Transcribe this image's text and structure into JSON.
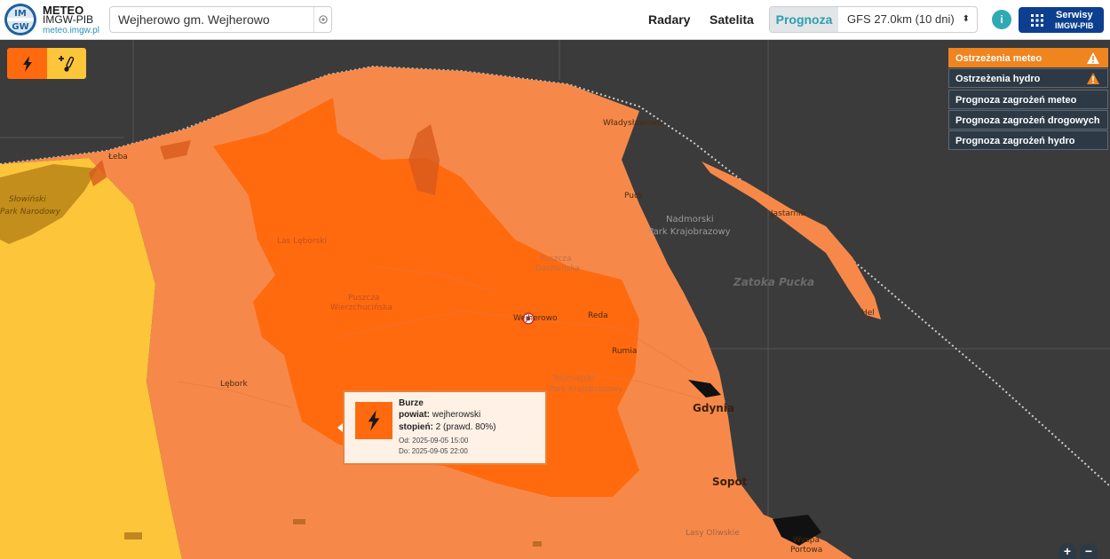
{
  "header": {
    "brand_line1": "METEO",
    "brand_line2": "IMGW-PIB",
    "brand_url": "meteo.imgw.pl",
    "logo_text_top": "IM",
    "logo_text_bottom": "GW",
    "search_value": "Wejherowo gm. Wejherowo",
    "nav": {
      "radary": "Radary",
      "satelita": "Satelita"
    },
    "prognoza_label": "Prognoza",
    "model_selected": "GFS 27.0km (10 dni)",
    "serwisy_line1": "Serwisy",
    "serwisy_line2": "IMGW-PIB",
    "info_symbol": "i"
  },
  "colors": {
    "accent": "#2a9fb0",
    "serwisy": "#0c3f8f",
    "warn_orange": "#ff6a0f",
    "warn_light_orange": "#f6894a",
    "warn_yellow": "#fcc53a",
    "sea": "#3a3a3a"
  },
  "toolbar": {
    "storm_icon": "lightning-icon",
    "temp_icon": "thermometer-plus-icon"
  },
  "warnings_menu": [
    {
      "label": "Ostrzeżenia meteo",
      "icon": "warning-icon",
      "active": true
    },
    {
      "label": "Ostrzeżenia hydro",
      "icon": "warning-icon",
      "active": false
    },
    {
      "label": "Prognoza zagrożeń meteo",
      "active": false
    },
    {
      "label": "Prognoza zagrożeń drogowych",
      "active": false
    },
    {
      "label": "Prognoza zagrożeń hydro",
      "active": false
    }
  ],
  "popup": {
    "title": "Burze",
    "powiat_label": "powiat:",
    "powiat_value": "wejherowski",
    "stopien_label": "stopień:",
    "stopien_value": "2 (prawd. 80%)",
    "from": "Od: 2025-09-05 15:00",
    "to": "Do: 2025-09-05 22:00"
  },
  "map_labels": {
    "leba": "Łeba",
    "wladyslawowo": "Władysławowo",
    "puck": "Puck",
    "jastarnia": "Jastarnia",
    "hel": "Hel",
    "nadmorski1": "Nadmorski",
    "nadmorski2": "Park Krajobrazowy",
    "zatoka": "Zatoka Pucka",
    "wejherowo": "Wejherowo",
    "reda": "Reda",
    "rumia": "Rumia",
    "lebork": "Lębork",
    "gdynia": "Gdynia",
    "sopot": "Sopot",
    "trojmiejski1": "Trójmiejski",
    "trojmiejski2": "Park Krajobrazowy",
    "puszcza1": "Puszcza",
    "puszcza2": "Darżlubska",
    "puszcza3": "Puszcza",
    "puszcza4": "Wierzchucińska",
    "las_lebora": "Las Lęborski",
    "slowinski1": "Słowiński",
    "slowinski2": "Park Narodowy",
    "lasy_oliwskie": "Lasy Oliwskie",
    "wyspa1": "Wyspa",
    "wyspa2": "Portowa"
  },
  "zoom": {
    "in": "+",
    "out": "−"
  }
}
